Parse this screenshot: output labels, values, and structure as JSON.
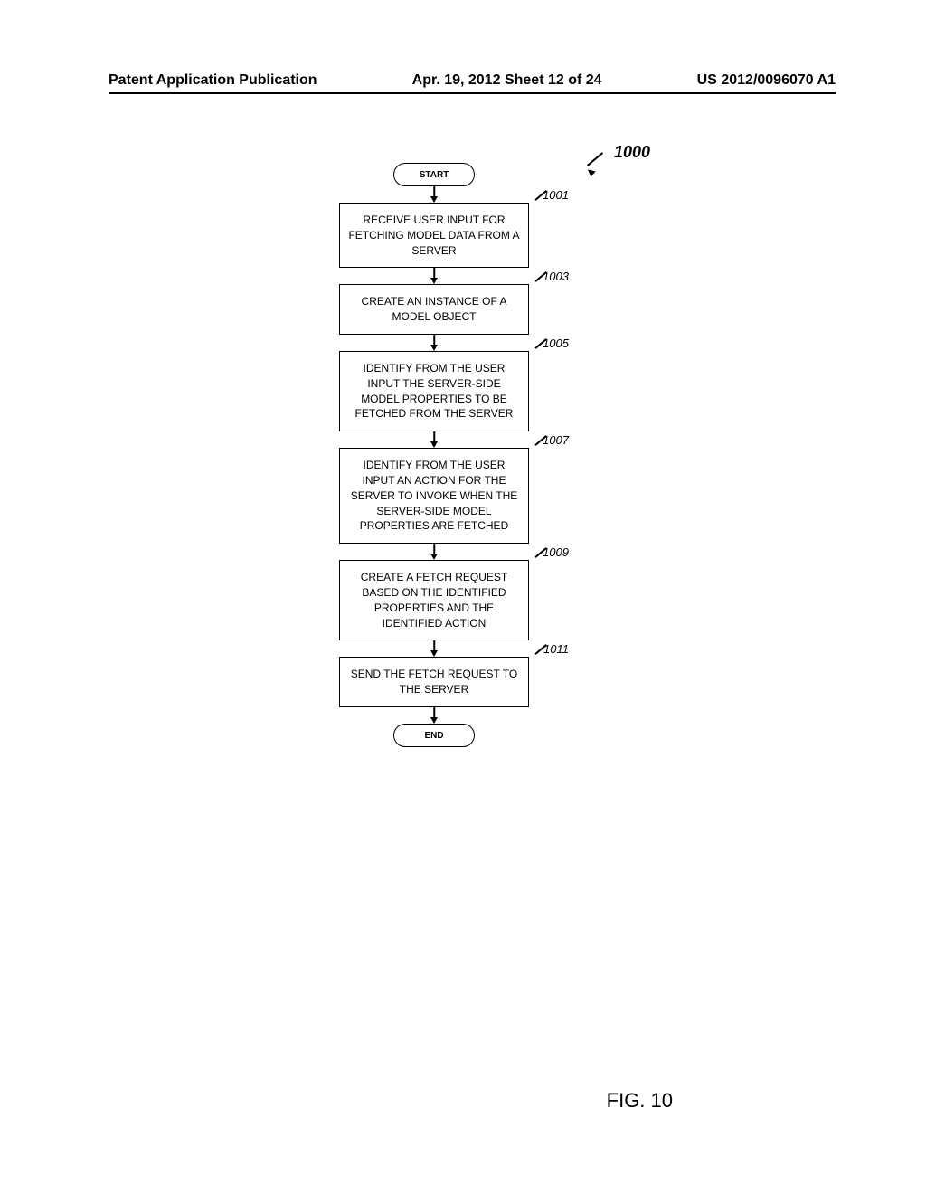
{
  "header": {
    "left": "Patent Application Publication",
    "center": "Apr. 19, 2012  Sheet 12 of 24",
    "right": "US 2012/0096070 A1"
  },
  "page_ref": "1000",
  "terminal_start": "START",
  "terminal_end": "END",
  "steps": [
    {
      "ref": "1001",
      "text": "RECEIVE USER INPUT FOR FETCHING MODEL DATA FROM A SERVER"
    },
    {
      "ref": "1003",
      "text": "CREATE AN INSTANCE OF A MODEL OBJECT"
    },
    {
      "ref": "1005",
      "text": "IDENTIFY FROM THE USER INPUT THE SERVER-SIDE MODEL PROPERTIES TO BE FETCHED FROM THE SERVER"
    },
    {
      "ref": "1007",
      "text": "IDENTIFY FROM THE USER INPUT AN ACTION FOR THE SERVER TO INVOKE WHEN THE SERVER-SIDE MODEL PROPERTIES ARE FETCHED"
    },
    {
      "ref": "1009",
      "text": "CREATE A FETCH REQUEST BASED ON THE IDENTIFIED PROPERTIES AND THE IDENTIFIED ACTION"
    },
    {
      "ref": "1011",
      "text": "SEND THE FETCH REQUEST TO THE SERVER"
    }
  ],
  "figure_label": "FIG. 10",
  "chart_data": {
    "type": "diagram",
    "diagram_type": "flowchart",
    "reference_number": "1000",
    "nodes": [
      {
        "id": "start",
        "type": "terminal",
        "text": "START"
      },
      {
        "id": "1001",
        "type": "process",
        "text": "RECEIVE USER INPUT FOR FETCHING MODEL DATA FROM A SERVER"
      },
      {
        "id": "1003",
        "type": "process",
        "text": "CREATE AN INSTANCE OF A MODEL OBJECT"
      },
      {
        "id": "1005",
        "type": "process",
        "text": "IDENTIFY FROM THE USER INPUT THE SERVER-SIDE MODEL PROPERTIES TO BE FETCHED FROM THE SERVER"
      },
      {
        "id": "1007",
        "type": "process",
        "text": "IDENTIFY FROM THE USER INPUT AN ACTION FOR THE SERVER TO INVOKE WHEN THE SERVER-SIDE MODEL PROPERTIES ARE FETCHED"
      },
      {
        "id": "1009",
        "type": "process",
        "text": "CREATE A FETCH REQUEST BASED ON THE IDENTIFIED PROPERTIES AND THE IDENTIFIED ACTION"
      },
      {
        "id": "1011",
        "type": "process",
        "text": "SEND THE FETCH REQUEST TO THE SERVER"
      },
      {
        "id": "end",
        "type": "terminal",
        "text": "END"
      }
    ],
    "edges": [
      {
        "from": "start",
        "to": "1001"
      },
      {
        "from": "1001",
        "to": "1003"
      },
      {
        "from": "1003",
        "to": "1005"
      },
      {
        "from": "1005",
        "to": "1007"
      },
      {
        "from": "1007",
        "to": "1009"
      },
      {
        "from": "1009",
        "to": "1011"
      },
      {
        "from": "1011",
        "to": "end"
      }
    ]
  }
}
